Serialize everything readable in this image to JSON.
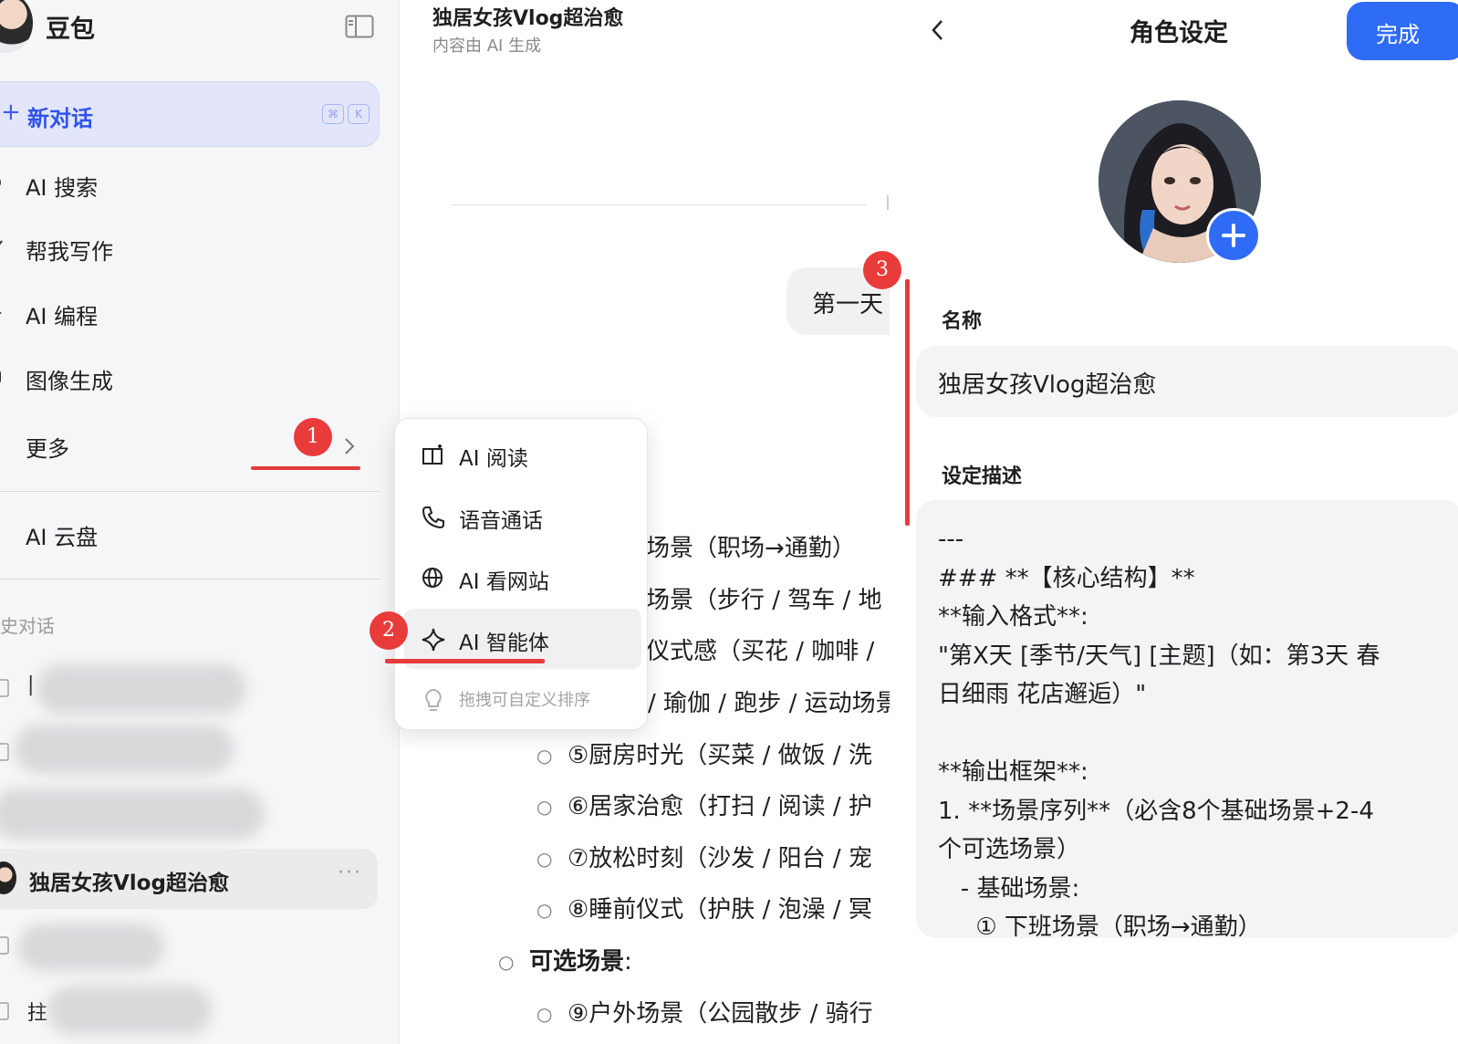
{
  "sidebar": {
    "app_name": "豆包",
    "new_chat": {
      "label": "新对话",
      "kbd1": "⌘",
      "kbd2": "K"
    },
    "nav": [
      {
        "label": "AI 搜索"
      },
      {
        "label": "帮我写作"
      },
      {
        "label": "AI 编程"
      },
      {
        "label": "图像生成"
      },
      {
        "label": "更多"
      },
      {
        "label": "AI 云盘"
      }
    ],
    "history_title": "史对话",
    "history_active": "独居女孩Vlog超治愈",
    "history_partial": [
      "|",
      "拄"
    ]
  },
  "chat": {
    "title": "独居女孩Vlog超治愈",
    "subtitle": "内容由 AI 生成",
    "bubble": "第一天",
    "lines": [
      "场景（职场→通勤）",
      "场景（步行 / 驾车 / 地",
      "仪式感（买花 / 咖啡 /",
      "/ 瑜伽 / 跑步 / 运动场景",
      "⑤厨房时光（买菜 / 做饭 / 洗",
      "⑥居家治愈（打扫 / 阅读 / 护",
      "⑦放松时刻（沙发 / 阳台 / 宠",
      "⑧睡前仪式（护肤 / 泡澡 / 冥"
    ],
    "optional_title": "可选场景",
    "optional_colon": ":",
    "optional_first": "⑨户外场景（公园散步 / 骑行"
  },
  "menu": {
    "items": [
      "AI 阅读",
      "语音通话",
      "AI 看网站",
      "AI 智能体"
    ],
    "hint": "拖拽可自定义排序"
  },
  "annotations": [
    "1",
    "2",
    "3"
  ],
  "panel": {
    "title": "角色设定",
    "done": "完成",
    "name_label": "名称",
    "name_value": "独居女孩Vlog超治愈",
    "desc_label": "设定描述",
    "desc_lines": [
      "---",
      "### **【核心结构】**",
      "**输入格式**:",
      "\"第X天 [季节/天气] [主题]（如：第3天 春",
      "日细雨 花店邂逅）\"",
      "",
      "**输出框架**:",
      "1. **场景序列**（必含8个基础场景+2-4",
      "个可选场景）",
      "   - 基础场景:",
      "     ① 下班场景（职场→通勤）"
    ]
  },
  "colors": {
    "accent": "#2f6cf6",
    "new_chat_bg": "#e3e6fb",
    "annotation_red": "#ea3b3b"
  }
}
